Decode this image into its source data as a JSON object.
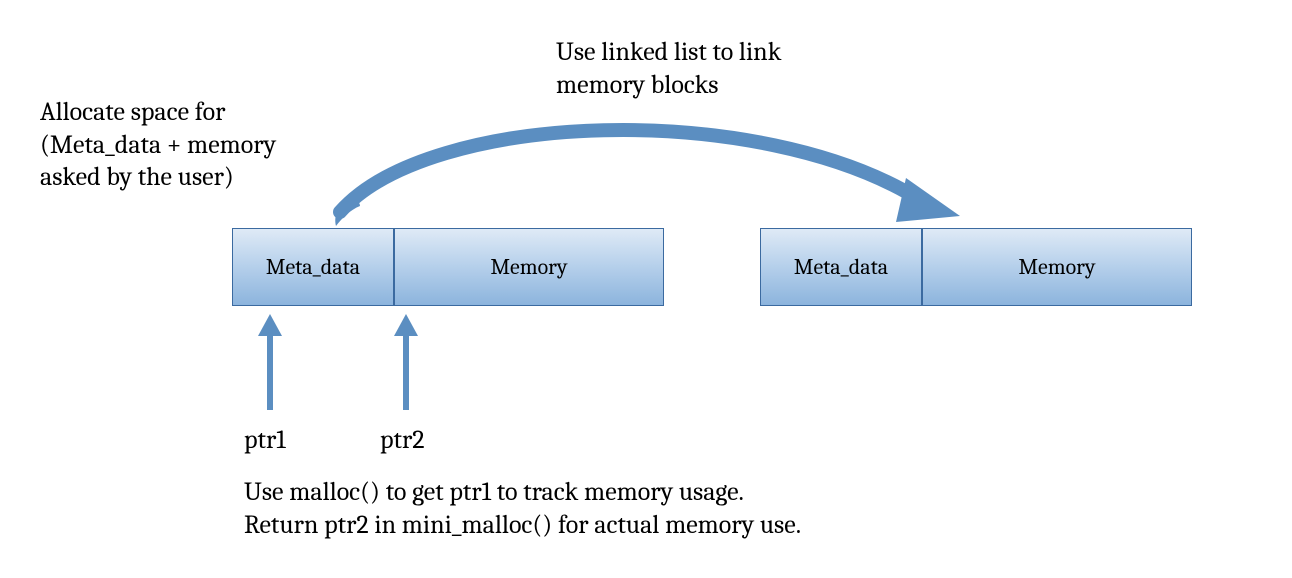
{
  "annotations": {
    "top_right_line1": "Use linked list to link",
    "top_right_line2": "memory blocks",
    "top_left_line1": "Allocate space for",
    "top_left_line2": "(Meta_data + memory",
    "top_left_line3": "asked by the user)",
    "bottom_line1": "Use malloc() to get ptr1 to track memory usage.",
    "bottom_line2": "Return ptr2 in mini_malloc() for actual memory use."
  },
  "pointers": {
    "ptr1": "ptr1",
    "ptr2": "ptr2"
  },
  "blocks": {
    "left_meta": "Meta_data",
    "left_mem": "Memory",
    "right_meta": "Meta_data",
    "right_mem": "Memory"
  },
  "colors": {
    "arrow": "#5b8ec1",
    "block_border": "#3b6aa0"
  }
}
